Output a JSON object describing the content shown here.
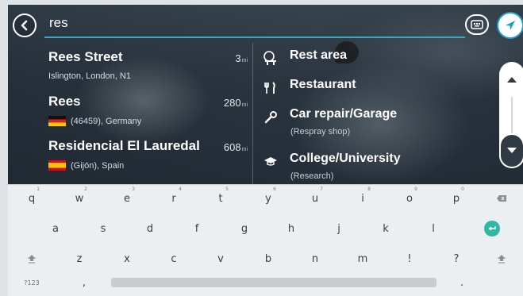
{
  "search": {
    "query": "res"
  },
  "results": [
    {
      "name": "Rees Street",
      "detail": "Islington, London, N1",
      "distance": "3",
      "unit": "mi",
      "flag": ""
    },
    {
      "name": "Rees",
      "detail": "(46459), Germany",
      "distance": "280",
      "unit": "mi",
      "flag": "germany-flag"
    },
    {
      "name": "Residencial El Lauredal",
      "detail": "(Gijón), Spain",
      "distance": "608",
      "unit": "mi",
      "flag": "spain-flag"
    }
  ],
  "categories": [
    {
      "label": "Rest area",
      "note": "",
      "icon": "rest-area-icon"
    },
    {
      "label": "Restaurant",
      "note": "",
      "icon": "restaurant-icon"
    },
    {
      "label": "Car repair/Garage",
      "note": "(Respray shop)",
      "icon": "wrench-icon"
    },
    {
      "label": "College/University",
      "note": "(Research)",
      "icon": "graduation-cap-icon"
    }
  ],
  "keyboard": {
    "row1": [
      "q",
      "w",
      "e",
      "r",
      "t",
      "y",
      "u",
      "i",
      "o",
      "p"
    ],
    "row1_hints": [
      "1",
      "2",
      "3",
      "4",
      "5",
      "6",
      "7",
      "8",
      "9",
      "0"
    ],
    "row2": [
      "a",
      "s",
      "d",
      "f",
      "g",
      "h",
      "j",
      "k",
      "l"
    ],
    "row3": [
      "z",
      "x",
      "c",
      "v",
      "b",
      "n",
      "m",
      "!",
      "?"
    ],
    "symbols_key": "?123",
    "comma_key": ",",
    "period_key": "."
  },
  "colors": {
    "accent": "#3aa6c6",
    "nav_button": "#1d9fc4",
    "enter_key": "#2fb8a4"
  }
}
